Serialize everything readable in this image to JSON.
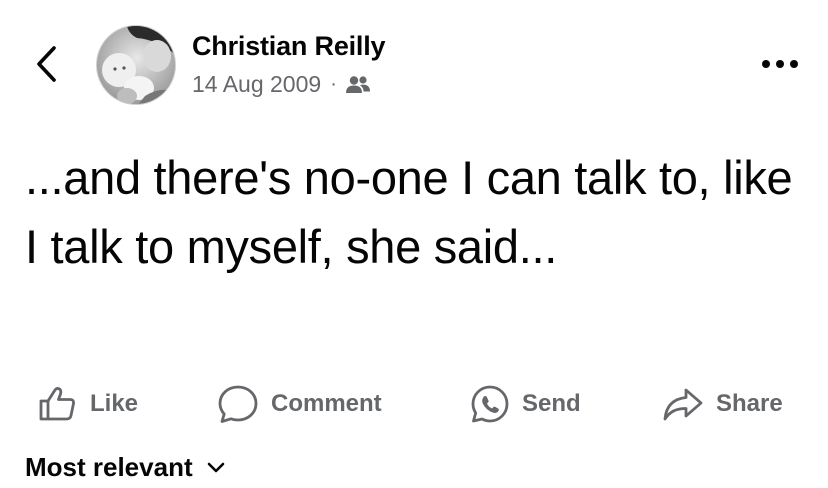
{
  "post": {
    "author_name": "Christian Reilly",
    "date": "14 Aug 2009",
    "separator": "·",
    "audience_icon": "friends-icon",
    "text": "...and there's no-one I can talk to, like I talk to myself, she said..."
  },
  "header": {
    "back_icon": "chevron-left-icon",
    "more_icon": "more-options-icon"
  },
  "actions": {
    "like_label": "Like",
    "comment_label": "Comment",
    "send_label": "Send",
    "share_label": "Share"
  },
  "comments": {
    "sort_label": "Most relevant"
  },
  "colors": {
    "primary_text": "#050505",
    "secondary_text": "#65676b",
    "background": "#ffffff"
  }
}
